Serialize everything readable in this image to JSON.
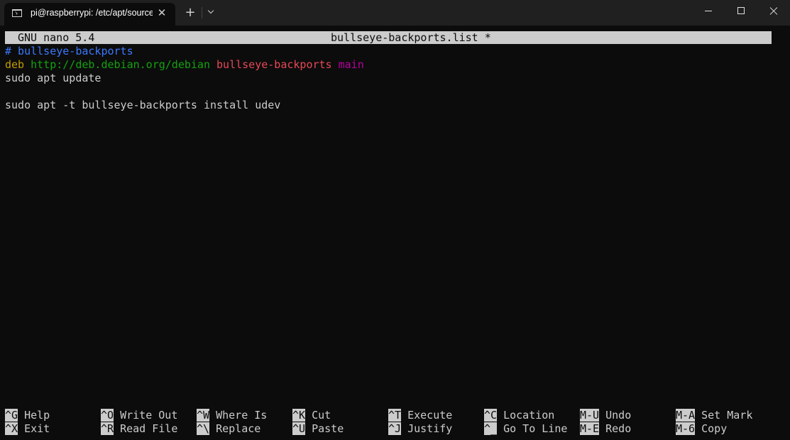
{
  "window": {
    "tab_title": "pi@raspberrypi: /etc/apt/sources.list.d",
    "tab_close": "✕",
    "new_tab": "+"
  },
  "nano": {
    "app_version": "GNU nano 5.4",
    "filename": "bullseye-backports.list *"
  },
  "content": {
    "line1": "# bullseye-backports",
    "line2_type": "deb",
    "line2_url": "http://deb.debian.org/debian",
    "line2_suite": "bullseye-backports",
    "line2_component": "main",
    "line3": "sudo apt update",
    "line4": "",
    "line5": "sudo apt -t bullseye-backports install udev"
  },
  "shortcuts": [
    {
      "key": "^G",
      "label": "Help"
    },
    {
      "key": "^O",
      "label": "Write Out"
    },
    {
      "key": "^W",
      "label": "Where Is"
    },
    {
      "key": "^K",
      "label": "Cut"
    },
    {
      "key": "^T",
      "label": "Execute"
    },
    {
      "key": "^C",
      "label": "Location"
    },
    {
      "key": "M-U",
      "label": "Undo"
    },
    {
      "key": "M-A",
      "label": "Set Mark"
    },
    {
      "key": "^X",
      "label": "Exit"
    },
    {
      "key": "^R",
      "label": "Read File"
    },
    {
      "key": "^\\",
      "label": "Replace"
    },
    {
      "key": "^U",
      "label": "Paste"
    },
    {
      "key": "^J",
      "label": "Justify"
    },
    {
      "key": "^_",
      "label": "Go To Line"
    },
    {
      "key": "M-E",
      "label": "Redo"
    },
    {
      "key": "M-6",
      "label": "Copy"
    }
  ],
  "colors": {
    "background": "#0c0c0c",
    "foreground": "#cccccc",
    "comment": "#3b78ff",
    "deb": "#c19c00",
    "url": "#13a10e",
    "suite": "#e74856",
    "component": "#b4009e"
  }
}
